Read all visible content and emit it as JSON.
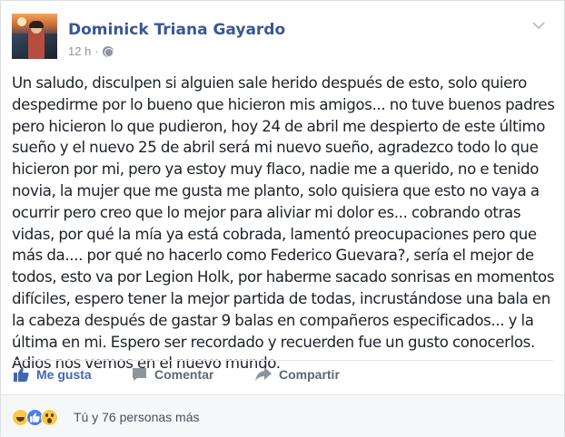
{
  "post": {
    "author": "Dominick Triana Gayardo",
    "timestamp": "12 h",
    "separator": "·",
    "privacy_icon": "globe-icon",
    "menu_icon": "chevron-down-icon",
    "text": "Un saludo, disculpen si alguien sale herido después de esto, solo quiero despedirme por lo bueno que hicieron mis amigos... no tuve buenos padres pero hicieron lo que pudieron, hoy 24 de abril me despierto de este último sueño y el nuevo 25 de abril será mi nuevo sueño, agradezco todo lo que hicieron por mi, pero ya estoy muy flaco, nadie me a querido, no e tenido novia, la mujer que me gusta me planto, solo quisiera que esto no vaya a ocurrir pero creo que lo mejor para aliviar mi dolor es... cobrando otras vidas, por qué la mía ya está cobrada, lamentó preocupaciones pero que más da.... por qué no hacerlo como Federico Guevara?, sería el mejor de todos, esto va por Legion Holk, por haberme sacado sonrisas en momentos difíciles, espero tener la mejor partida de todas, incrustándose una bala en la cabeza después de gastar 9 balas en compañeros especificados... y la última en mi. Espero ser recordado y recuerden fue un gusto conocerlos. Adios nos vemos en el nuevo mundo."
  },
  "actions": {
    "like_label": "Me gusta",
    "comment_label": "Comentar",
    "share_label": "Compartir"
  },
  "reactions": {
    "icons": [
      "haha",
      "like",
      "wow"
    ],
    "summary": "Tú y 76 personas más"
  },
  "colors": {
    "link": "#365899",
    "like_active": "#4267b2",
    "secondary_text": "#90949c",
    "action_text": "#606770"
  }
}
